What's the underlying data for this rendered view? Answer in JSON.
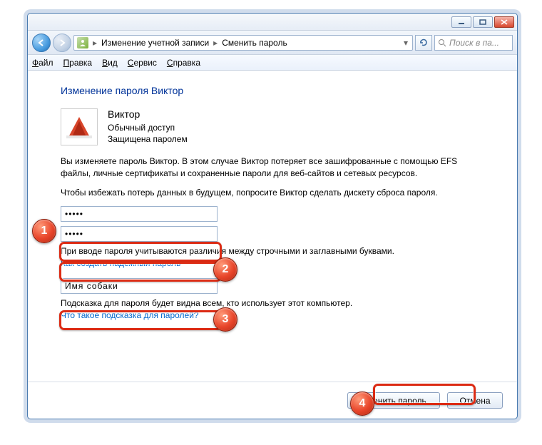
{
  "titlebar": {},
  "nav": {
    "breadcrumb_parent": "Изменение учетной записи",
    "breadcrumb_current": "Сменить пароль",
    "search_placeholder": "Поиск в па..."
  },
  "menubar": {
    "file": "Файл",
    "edit": "Правка",
    "view": "Вид",
    "tools": "Сервис",
    "help": "Справка"
  },
  "page": {
    "heading": "Изменение пароля Виктор",
    "user": {
      "name": "Виктор",
      "role": "Обычный доступ",
      "status": "Защищена паролем"
    },
    "warning_line1": "Вы изменяете пароль Виктор. В этом случае Виктор потеряет все зашифрованные с помощью EFS файлы, личные сертификаты и сохраненные пароли для веб-сайтов и сетевых ресурсов.",
    "warning_line2": "Чтобы избежать потерь данных в будущем, попросите Виктор сделать дискету сброса пароля.",
    "password1": "•••••",
    "password2": "•••••",
    "case_hint": "При вводе пароля учитываются различия между строчными и заглавными буквами.",
    "link_strong_password": "Как создать надежный пароль",
    "hint_value": "Имя собаки",
    "hint_explain": "Подсказка для пароля будет видна всем, кто использует этот компьютер.",
    "link_hint_help": "Что такое подсказка для паролей?"
  },
  "footer": {
    "confirm": "Сменить пароль",
    "cancel": "Отмена"
  },
  "markers": {
    "m1": "1",
    "m2": "2",
    "m3": "3",
    "m4": "4"
  }
}
